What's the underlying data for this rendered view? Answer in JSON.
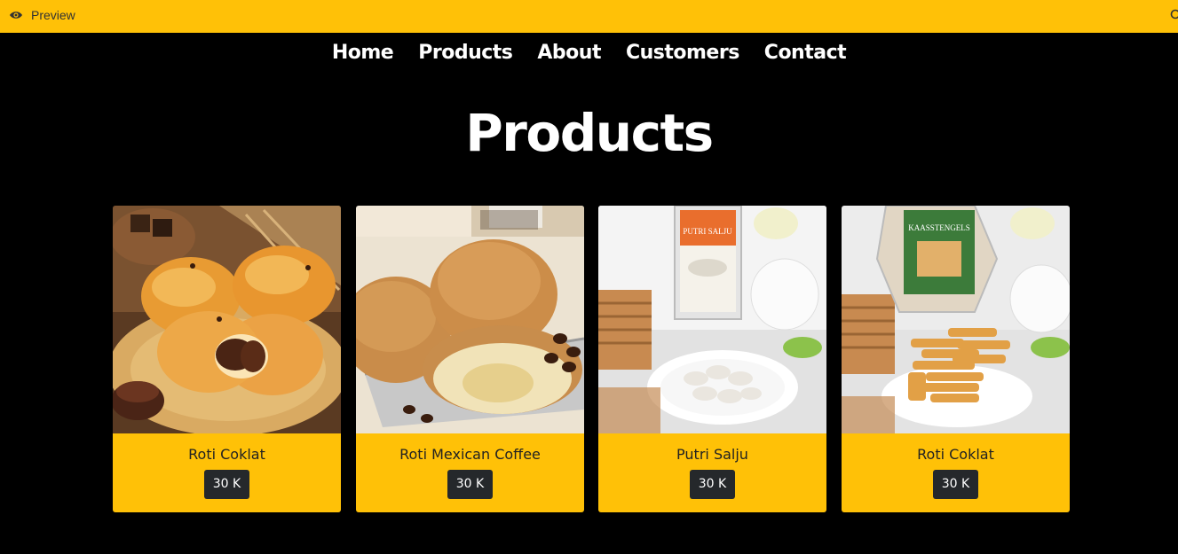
{
  "preview_bar": {
    "label": "Preview",
    "eye_icon": "eye-icon",
    "right_icon": "search-icon",
    "color": "#ffc107"
  },
  "nav": {
    "items": [
      "Home",
      "Products",
      "About",
      "Customers",
      "Contact"
    ]
  },
  "page": {
    "title": "Products"
  },
  "products": [
    {
      "name": "Roti Coklat",
      "price": "30 K"
    },
    {
      "name": "Roti Mexican Coffee",
      "price": "30 K"
    },
    {
      "name": "Putri Salju",
      "price": "30 K"
    },
    {
      "name": "Roti Coklat",
      "price": "30 K"
    }
  ],
  "package_labels": {
    "putri_salju": "PUTRI SALJU",
    "kaasstengels": "KAASSTENGELS"
  },
  "colors": {
    "accent": "#ffc107",
    "background": "#000000",
    "price_badge": "#25282b"
  }
}
